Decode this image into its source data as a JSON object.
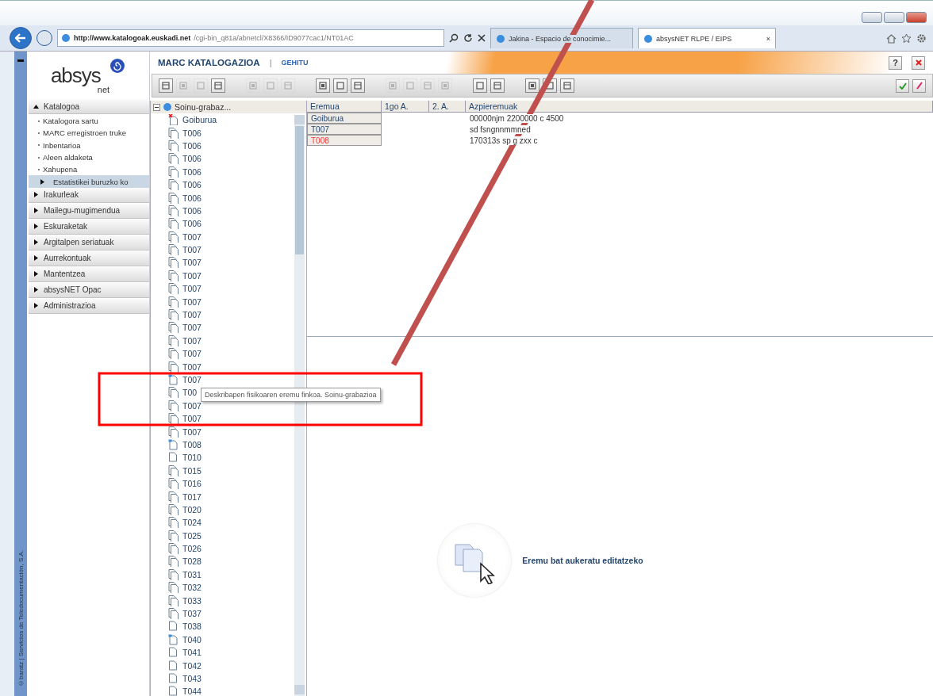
{
  "browser": {
    "url_host": "http://www.katalogoak.euskadi.net",
    "url_path": "/cgi-bin_q81a/abnetcl/X8366/ID9077cac1/NT01AC",
    "tabs": [
      {
        "label": "Jakina - Espacio de conocimie...",
        "selected": false
      },
      {
        "label": "absysNET RLPE / EIPS",
        "selected": true,
        "close": "×"
      }
    ]
  },
  "side_strip": "©baratz | Servicios de Teledocumentación, S.A.",
  "logo": {
    "word": "absys",
    "sub": "net"
  },
  "menu": [
    {
      "label": "Katalogoa",
      "expanded": true,
      "children": [
        {
          "label": "Katalogora sartu",
          "kind": "link",
          "selected": false
        },
        {
          "label": "MARC erregistroen truke",
          "kind": "link",
          "selected": false
        },
        {
          "label": "Inbentarioa",
          "kind": "link",
          "selected": false
        },
        {
          "label": "Aleen aldaketa",
          "kind": "link",
          "selected": false
        },
        {
          "label": "Xahupena",
          "kind": "link",
          "selected": false
        },
        {
          "label": "Estatistikei buruzko ko",
          "kind": "submenu",
          "selected": true
        }
      ]
    },
    {
      "label": "Irakurleak",
      "expanded": false
    },
    {
      "label": "Mailegu-mugimendua",
      "expanded": false
    },
    {
      "label": "Eskuraketak",
      "expanded": false
    },
    {
      "label": "Argitalpen seriatuak",
      "expanded": false
    },
    {
      "label": "Aurrekontuak",
      "expanded": false
    },
    {
      "label": "Mantentzea",
      "expanded": false
    },
    {
      "label": "absysNET Opac",
      "expanded": false
    },
    {
      "label": "Administrazioa",
      "expanded": false
    }
  ],
  "header": {
    "title": "MARC KATALOGAZIOA",
    "separator": "|",
    "action": "GEHITU",
    "help": "?"
  },
  "toolbar": [
    {
      "disabled": false
    },
    {
      "disabled": true
    },
    {
      "disabled": true
    },
    {
      "disabled": false
    },
    {
      "disabled": true
    },
    {
      "disabled": true
    },
    {
      "disabled": true
    },
    {
      "disabled": false
    },
    {
      "disabled": false
    },
    {
      "disabled": false
    },
    {
      "disabled": true
    },
    {
      "disabled": true
    },
    {
      "disabled": true
    },
    {
      "disabled": true
    },
    {
      "disabled": false
    },
    {
      "disabled": false
    },
    {
      "disabled": false
    },
    {
      "disabled": false
    },
    {
      "disabled": false
    }
  ],
  "tree": {
    "root": {
      "label": "Soinu-grabaz...",
      "expanded": true
    },
    "items": [
      {
        "label": "Goiburua",
        "kind": "header"
      },
      {
        "label": "T006",
        "kind": "multi"
      },
      {
        "label": "T006",
        "kind": "multi"
      },
      {
        "label": "T006",
        "kind": "multi"
      },
      {
        "label": "T006",
        "kind": "multi"
      },
      {
        "label": "T006",
        "kind": "multi"
      },
      {
        "label": "T006",
        "kind": "multi"
      },
      {
        "label": "T006",
        "kind": "multi"
      },
      {
        "label": "T006",
        "kind": "multi"
      },
      {
        "label": "T007",
        "kind": "multi"
      },
      {
        "label": "T007",
        "kind": "multi"
      },
      {
        "label": "T007",
        "kind": "multi"
      },
      {
        "label": "T007",
        "kind": "multi"
      },
      {
        "label": "T007",
        "kind": "multi"
      },
      {
        "label": "T007",
        "kind": "multi"
      },
      {
        "label": "T007",
        "kind": "multi"
      },
      {
        "label": "T007",
        "kind": "multi"
      },
      {
        "label": "T007",
        "kind": "multi"
      },
      {
        "label": "T007",
        "kind": "multi"
      },
      {
        "label": "T007",
        "kind": "multi"
      },
      {
        "label": "T007",
        "kind": "fixed"
      },
      {
        "label": "T00",
        "kind": "multi"
      },
      {
        "label": "T007",
        "kind": "multi"
      },
      {
        "label": "T007",
        "kind": "multi"
      },
      {
        "label": "T007",
        "kind": "multi"
      },
      {
        "label": "T008",
        "kind": "fixed"
      },
      {
        "label": "T010",
        "kind": "single"
      },
      {
        "label": "T015",
        "kind": "multi"
      },
      {
        "label": "T016",
        "kind": "multi"
      },
      {
        "label": "T017",
        "kind": "multi"
      },
      {
        "label": "T020",
        "kind": "multi"
      },
      {
        "label": "T024",
        "kind": "multi"
      },
      {
        "label": "T025",
        "kind": "multi"
      },
      {
        "label": "T026",
        "kind": "multi"
      },
      {
        "label": "T028",
        "kind": "multi"
      },
      {
        "label": "T031",
        "kind": "multi"
      },
      {
        "label": "T032",
        "kind": "multi"
      },
      {
        "label": "T033",
        "kind": "multi"
      },
      {
        "label": "T037",
        "kind": "multi"
      },
      {
        "label": "T038",
        "kind": "single"
      },
      {
        "label": "T040",
        "kind": "fixed"
      },
      {
        "label": "T041",
        "kind": "single"
      },
      {
        "label": "T042",
        "kind": "single"
      },
      {
        "label": "T043",
        "kind": "single"
      },
      {
        "label": "T044",
        "kind": "single"
      }
    ]
  },
  "tooltip": "Deskribapen fisikoaren eremu finkoa. Soinu-grabazioa",
  "table": {
    "columns": [
      "Eremua",
      "1go A.",
      "2. A.",
      "Azpieremuak"
    ],
    "rows": [
      {
        "field": "Goiburua",
        "invalid": false,
        "subfields": "00000njm 2200000 c 4500"
      },
      {
        "field": "T007",
        "invalid": false,
        "subfields": "sd fsngnnmmned"
      },
      {
        "field": "T008",
        "invalid": true,
        "subfields": "170313s sp g zxx c"
      }
    ]
  },
  "editor": {
    "message": "Eremu bat aukeratu editatzeko"
  }
}
